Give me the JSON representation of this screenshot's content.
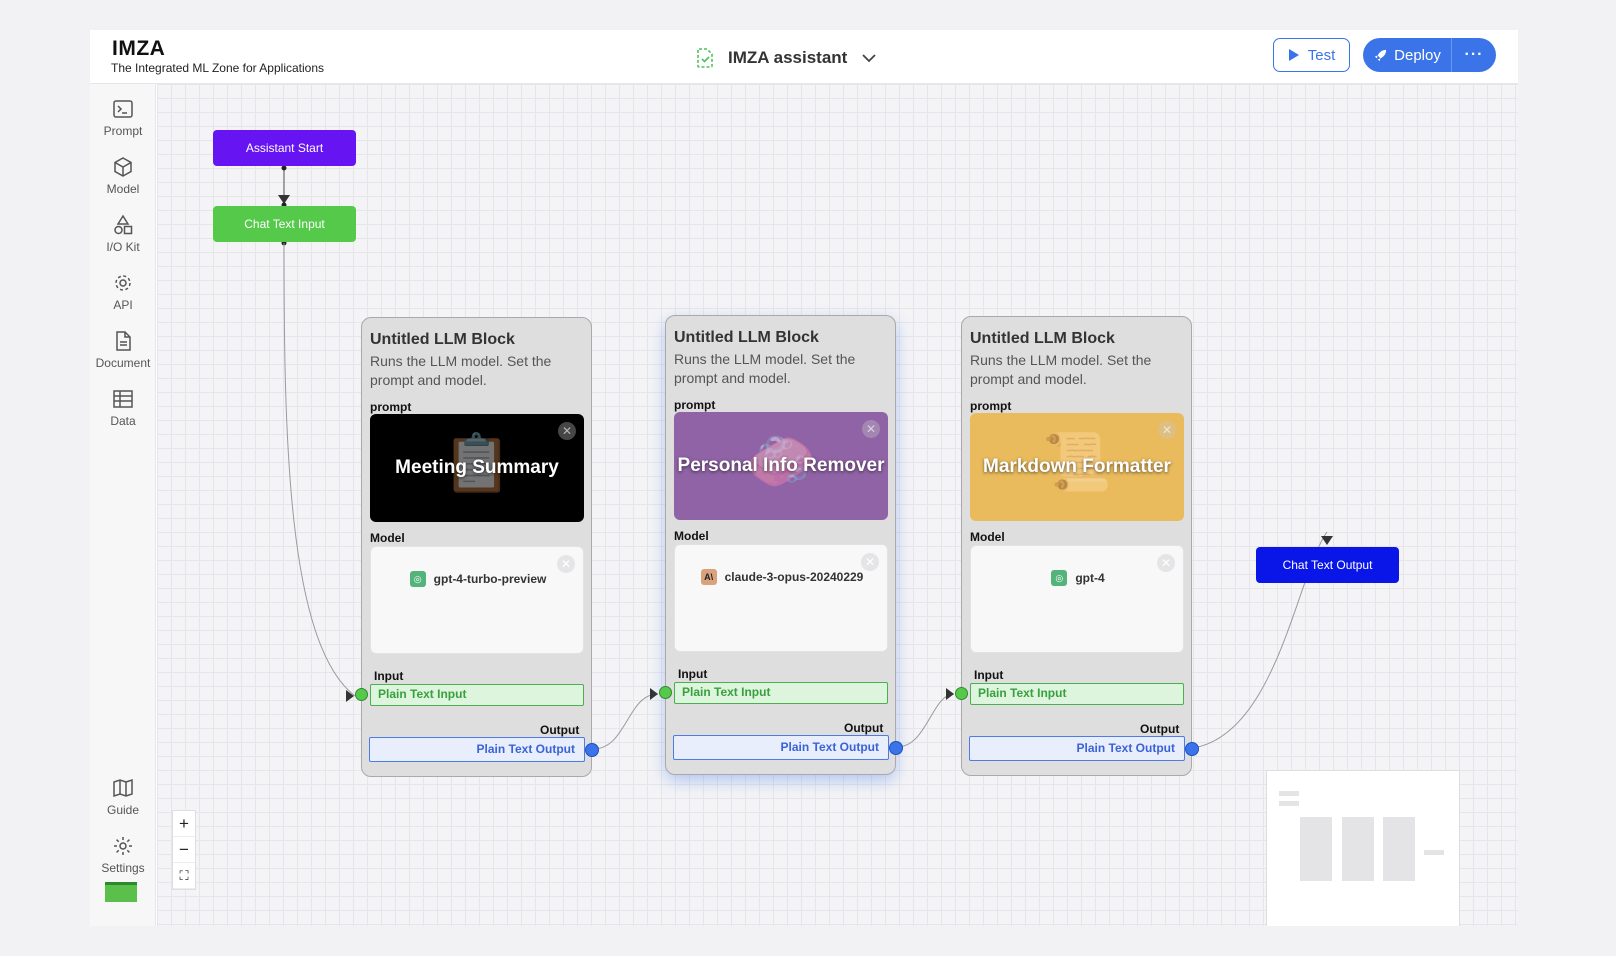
{
  "header": {
    "brand_title": "IMZA",
    "brand_subtitle": "The Integrated ML Zone for Applications",
    "assistant_name": "IMZA assistant",
    "test_label": "Test",
    "deploy_label": "Deploy",
    "more_label": "···",
    "accent_color": "#3b74e8"
  },
  "sidebar": {
    "top_items": [
      {
        "label": "Prompt",
        "icon": "terminal-icon"
      },
      {
        "label": "Model",
        "icon": "cube-icon"
      },
      {
        "label": "I/O Kit",
        "icon": "shapes-icon"
      },
      {
        "label": "API",
        "icon": "gear-icon"
      },
      {
        "label": "Document",
        "icon": "document-icon"
      },
      {
        "label": "Data",
        "icon": "table-icon"
      }
    ],
    "bottom_items": [
      {
        "label": "Guide",
        "icon": "map-icon"
      },
      {
        "label": "Settings",
        "icon": "settings-icon"
      }
    ]
  },
  "canvas": {
    "nodes": {
      "start": {
        "label": "Assistant Start",
        "color": "#6614f2"
      },
      "chat_input": {
        "label": "Chat Text Input",
        "color": "#55c94a"
      },
      "chat_output": {
        "label": "Chat Text Output",
        "color": "#0a16e8"
      }
    },
    "blocks": [
      {
        "title": "Untitled LLM Block",
        "description": "Runs the LLM model. Set the prompt and model.",
        "prompt_label": "prompt",
        "prompt_name": "Meeting Summary",
        "prompt_icon": "clipboard-icon",
        "prompt_color": "#000000",
        "model_label": "Model",
        "model_name": "gpt-4-turbo-preview",
        "model_logo": "openai-icon",
        "input_label": "Input",
        "input_port": "Plain Text Input",
        "output_label": "Output",
        "output_port": "Plain Text Output"
      },
      {
        "title": "Untitled LLM Block",
        "description": "Runs the LLM model. Set the prompt and model.",
        "prompt_label": "prompt",
        "prompt_name": "Personal Info Remover",
        "prompt_icon": "soap-icon",
        "prompt_color": "#8f63a5",
        "model_label": "Model",
        "model_name": "claude-3-opus-20240229",
        "model_logo": "anthropic-icon",
        "input_label": "Input",
        "input_port": "Plain Text Input",
        "output_label": "Output",
        "output_port": "Plain Text Output"
      },
      {
        "title": "Untitled LLM Block",
        "description": "Runs the LLM model. Set the prompt and model.",
        "prompt_label": "prompt",
        "prompt_name": "Markdown Formatter",
        "prompt_icon": "scroll-icon",
        "prompt_color": "#e9bb5d",
        "model_label": "Model",
        "model_name": "gpt-4",
        "model_logo": "openai-icon",
        "input_label": "Input",
        "input_port": "Plain Text Input",
        "output_label": "Output",
        "output_port": "Plain Text Output"
      }
    ]
  },
  "zoom": {
    "plus": "+",
    "minus": "−",
    "fit": "⛶"
  }
}
